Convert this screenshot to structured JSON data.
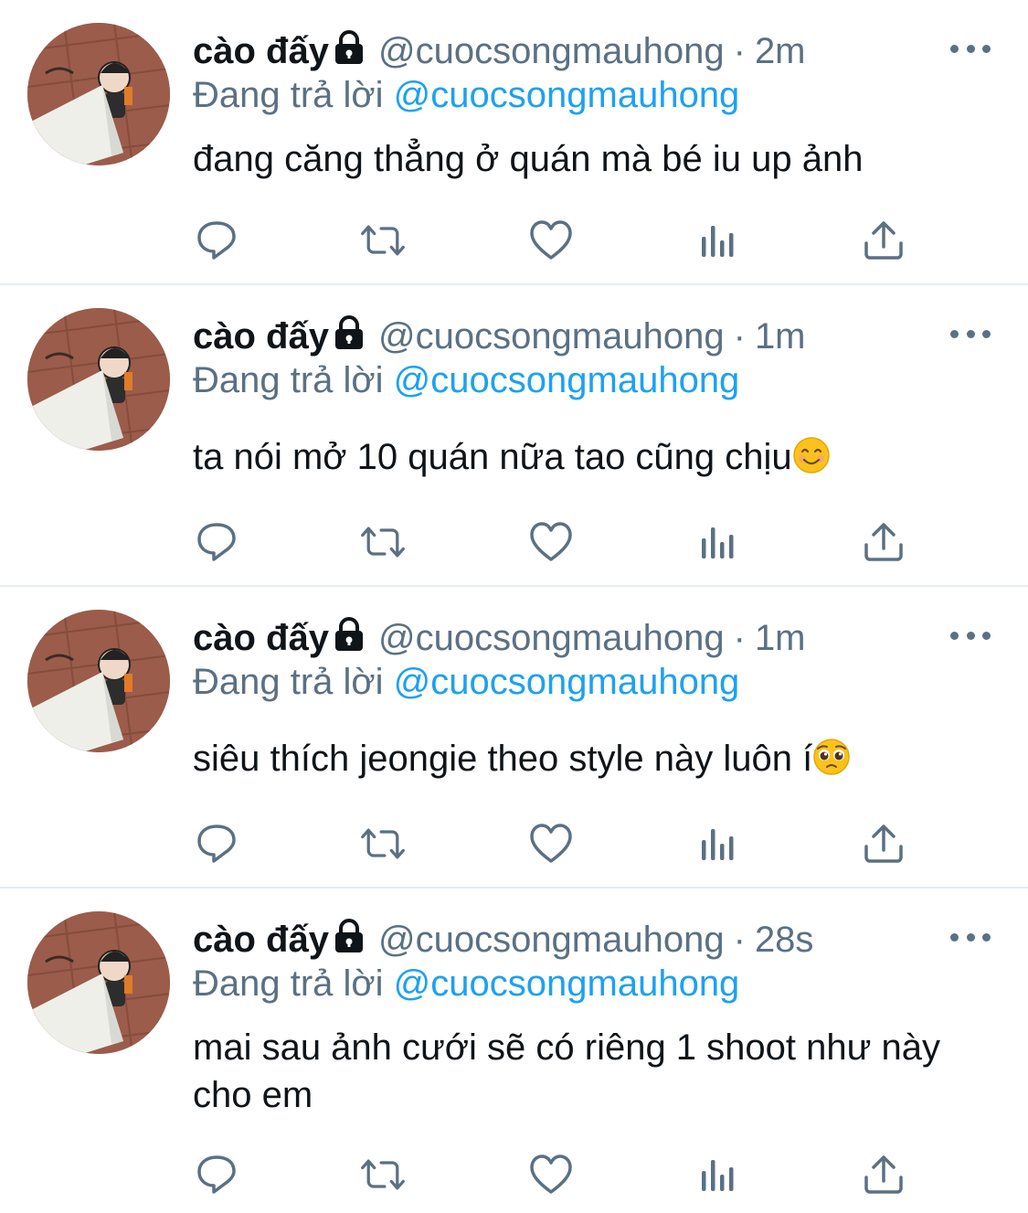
{
  "colors": {
    "text_primary": "#0f1419",
    "text_secondary": "#5b7083",
    "link_blue": "#1da1f2",
    "divider": "#e6ecf0"
  },
  "icons": [
    "lock-icon",
    "more-icon",
    "reply-icon",
    "retweet-icon",
    "like-icon",
    "analytics-icon",
    "share-icon"
  ],
  "tweets": [
    {
      "name": "cào đấy",
      "handle": "@cuocsongmauhong",
      "separator": "·",
      "time": "2m",
      "reply_prefix": "Đang trả lời",
      "reply_to": "@cuocsongmauhong",
      "text": "đang căng thẳng ở quán mà bé iu up ảnh",
      "emoji": ""
    },
    {
      "name": "cào đấy",
      "handle": "@cuocsongmauhong",
      "separator": "·",
      "time": "1m",
      "reply_prefix": "Đang trả lời",
      "reply_to": "@cuocsongmauhong",
      "text": "ta nói mở 10 quán nữa tao cũng chịu",
      "emoji": "smiling-face-emoji"
    },
    {
      "name": "cào đấy",
      "handle": "@cuocsongmauhong",
      "separator": "·",
      "time": "1m",
      "reply_prefix": "Đang trả lời",
      "reply_to": "@cuocsongmauhong",
      "text": "siêu thích jeongie theo style này luôn í",
      "emoji": "pleading-face-emoji"
    },
    {
      "name": "cào đấy",
      "handle": "@cuocsongmauhong",
      "separator": "·",
      "time": "28s",
      "reply_prefix": "Đang trả lời",
      "reply_to": "@cuocsongmauhong",
      "text": "mai sau ảnh cưới sẽ có riêng 1 shoot như này cho em",
      "emoji": ""
    }
  ]
}
